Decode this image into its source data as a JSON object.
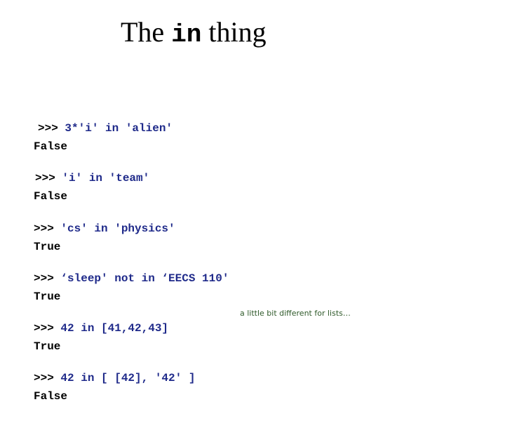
{
  "slide": {
    "title": {
      "before": "The ",
      "code": "in",
      "after": " thing"
    },
    "examples": [
      {
        "prompt": ">>> ",
        "expression": "3*'i' in 'alien'",
        "result": "False"
      },
      {
        "prompt": ">>> ",
        "expression": "'i' in 'team'",
        "result": "False"
      },
      {
        "prompt": ">>> ",
        "expression": "'cs' in 'physics'",
        "result": "True"
      },
      {
        "prompt": ">>> ",
        "expression": "‘sleep' not in ‘EECS 110'",
        "result": "True"
      },
      {
        "prompt": ">>> ",
        "expression": "42 in [41,42,43]",
        "result": "True"
      },
      {
        "prompt": ">>> ",
        "expression": "42 in [ [42], '42' ]",
        "result": "False"
      }
    ],
    "note": "a little bit different for lists…",
    "colors": {
      "expression": "#1f2a8a",
      "result": "#000000",
      "note": "#2f5a2a"
    }
  }
}
